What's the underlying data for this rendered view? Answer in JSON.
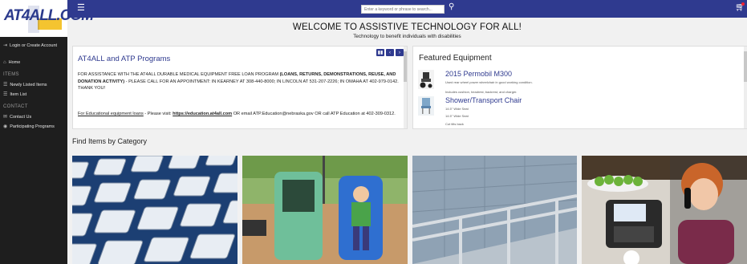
{
  "brand": {
    "logo_text": "AT4ALL.COM"
  },
  "sidebar": {
    "login_label": "Login or Create Account",
    "items": [
      {
        "label": "Home",
        "icon": "home-icon"
      },
      {
        "heading": "ITEMS"
      },
      {
        "label": "Newly Listed Items",
        "icon": "list-icon"
      },
      {
        "label": "Item List",
        "icon": "list-icon"
      },
      {
        "heading": "CONTACT"
      },
      {
        "label": "Contact Us",
        "icon": "mail-icon"
      },
      {
        "label": "Participating Programs",
        "icon": "location-icon"
      }
    ]
  },
  "topbar": {
    "search_placeholder": "Enter a keyword or phrase to search..."
  },
  "welcome": {
    "title": "WELCOME TO ASSISTIVE TECHNOLOGY FOR ALL!",
    "subtitle": "Technology to benefit individuals with disabilities"
  },
  "programs": {
    "title": "AT4ALL and ATP Programs",
    "p1_a": "FOR ASSISTANCE WITH THE AT4ALL DURABLE MEDICAL EQUIPMENT FREE LOAN PROGRAM ",
    "p1_b": "(LOANS, RETURNS, DEMONSTRATIONS, REUSE, AND DONATION ACTIVITY)",
    "p1_c": " - PLEASE CALL FOR AN APPOINTMENT: IN KEARNEY AT 308-440-8000; IN LINCOLN AT 531-207-2226; IN OMAHA AT 402-979-0142. THANK YOU!",
    "p2_a": "For Educational equipment loans",
    "p2_b": " - Please visit: ",
    "p2_link": "https://education.at4all.com",
    "p2_c": " OR email ATP.Education@nebraska.gov OR call ATP Education at 402-309-0312."
  },
  "featured": {
    "title": "Featured Equipment",
    "items": [
      {
        "title": "2015 Permobil M300",
        "desc": [
          "Used rear wheel power wheelchair in good working condition.",
          "Includes cushion, headrest, backrest, and charger."
        ]
      },
      {
        "title": "Shower/Transport Chair",
        "desc": [
          "14.5\" Wide Seat",
          "14.5\" Wide Seat",
          "Cut tilts back"
        ]
      }
    ]
  },
  "categories": {
    "title": "Find Items by Category"
  },
  "colors": {
    "primary": "#2f3a8f",
    "sidebar": "#1e1e1e"
  }
}
